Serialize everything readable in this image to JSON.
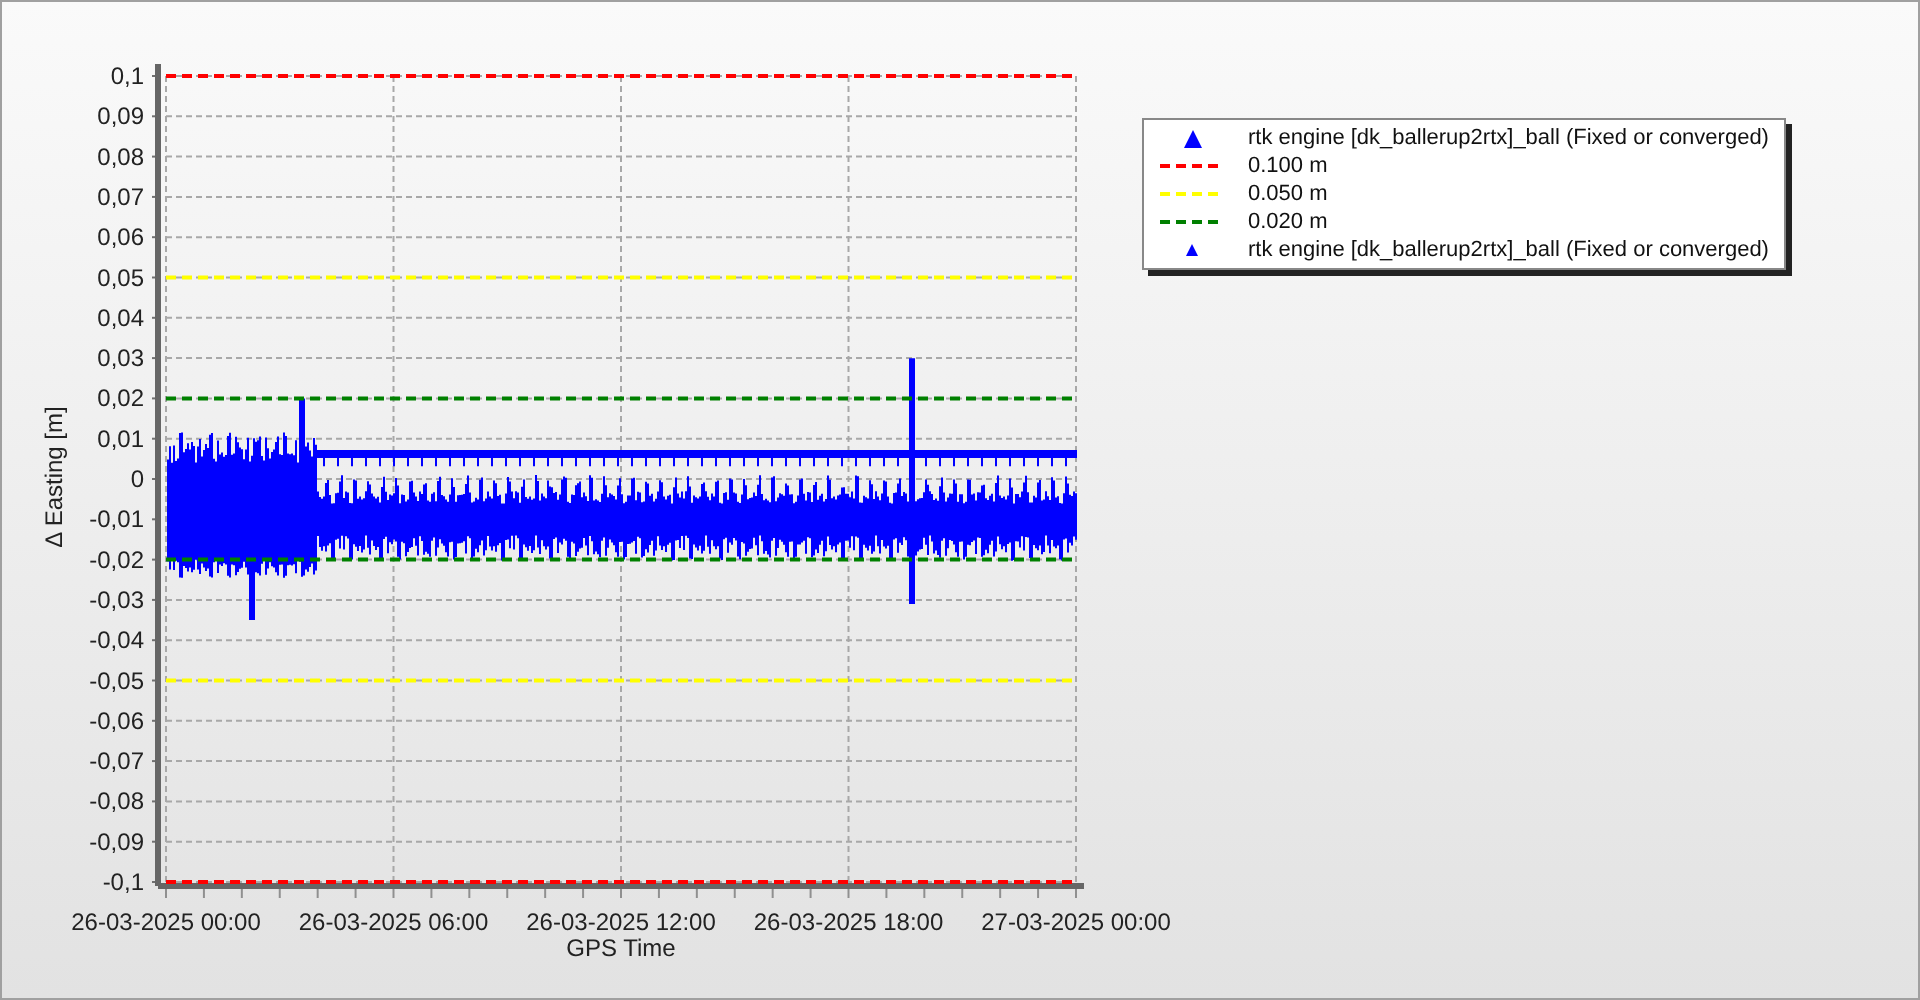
{
  "chart": {
    "chart_data": {
      "type": "line",
      "xlabel": "GPS Time",
      "ylabel": "Δ Easting [m]",
      "categories": [
        "26-03-2025 00:00",
        "26-03-2025 06:00",
        "26-03-2025 12:00",
        "26-03-2025 18:00",
        "27-03-2025 00:00"
      ],
      "ylim": [
        -0.1,
        0.1
      ],
      "grid": true,
      "ref_lines": [
        {
          "axis": "y",
          "value": -0.1,
          "color": "#ff0000",
          "line_style": "dashed"
        },
        {
          "axis": "y",
          "value": -0.05,
          "color": "#ffff00",
          "line_style": "dashed"
        },
        {
          "axis": "y",
          "value": -0.02,
          "color": "#008000",
          "line_style": "dashed"
        }
      ],
      "yticks": [
        {
          "value": 0.1,
          "label": "0,1"
        },
        {
          "value": 0.09,
          "label": "0,09"
        },
        {
          "value": 0.08,
          "label": "0,08"
        },
        {
          "value": 0.07,
          "label": "0,07"
        },
        {
          "value": 0.06,
          "label": "0,06"
        },
        {
          "value": 0.05,
          "label": "0,05"
        },
        {
          "value": 0.04,
          "label": "0,04"
        },
        {
          "value": 0.03,
          "label": "0,03"
        },
        {
          "value": 0.02,
          "label": "0,02"
        },
        {
          "value": 0.01,
          "label": "0,01"
        },
        {
          "value": 0,
          "label": "0"
        },
        {
          "value": -0.01,
          "label": "-0,01"
        },
        {
          "value": -0.02,
          "label": "-0,02"
        },
        {
          "value": -0.03,
          "label": "-0,03"
        },
        {
          "value": -0.04,
          "label": "-0,04"
        },
        {
          "value": -0.05,
          "label": "-0,05"
        },
        {
          "value": -0.06,
          "label": "-0,06"
        },
        {
          "value": -0.07,
          "label": "-0,07"
        },
        {
          "value": -0.08,
          "label": "-0,08"
        },
        {
          "value": -0.09,
          "label": "-0,09"
        },
        {
          "value": -0.1,
          "label": "-0,1"
        }
      ],
      "series": [
        {
          "name": "0.100 m",
          "color": "#ff0000",
          "line_style": "dashed",
          "values": [
            0.1,
            0.1,
            0.1,
            0.1,
            0.1
          ]
        },
        {
          "name": "0.050 m",
          "color": "#ffff00",
          "line_style": "dashed",
          "values": [
            0.05,
            0.05,
            0.05,
            0.05,
            0.05
          ]
        },
        {
          "name": "0.020 m",
          "color": "#008000",
          "line_style": "dashed",
          "values": [
            0.02,
            0.02,
            0.02,
            0.02,
            0.02
          ]
        }
      ]
    }
  },
  "legend": {
    "first": {
      "color": "#0000ff",
      "label": "rtk engine [dk_ballerup2rtx]_ball (Fixed or converged)"
    },
    "last": {
      "color": "#0000ff",
      "label": "rtk engine [dk_ballerup2rtx]_ball (Fixed or converged)"
    }
  }
}
